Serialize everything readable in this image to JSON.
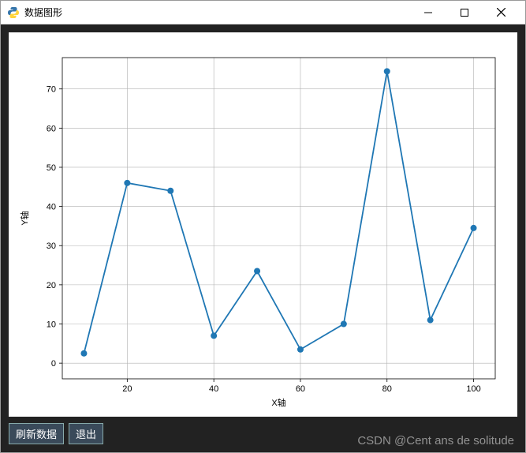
{
  "window": {
    "title": "数据图形"
  },
  "buttons": {
    "refresh": "刷新数据",
    "exit": "退出"
  },
  "watermark": "CSDN @Cent ans de solitude",
  "chart_data": {
    "type": "line",
    "xlabel": "X轴",
    "ylabel": "Y轴",
    "x": [
      10,
      20,
      30,
      40,
      50,
      60,
      70,
      80,
      90,
      100
    ],
    "y": [
      2.5,
      46,
      44,
      7,
      23.5,
      3.5,
      10,
      74.5,
      11,
      34.5
    ],
    "xlim": [
      5,
      105
    ],
    "ylim": [
      -4,
      78
    ],
    "xticks": [
      20,
      40,
      60,
      80,
      100
    ],
    "yticks": [
      0,
      10,
      20,
      30,
      40,
      50,
      60,
      70
    ]
  }
}
